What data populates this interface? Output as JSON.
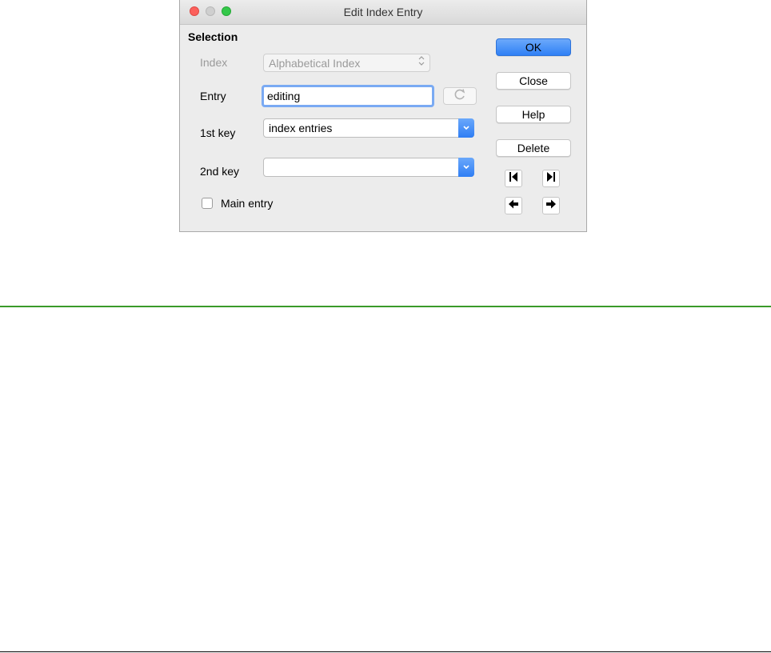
{
  "window": {
    "title": "Edit Index Entry"
  },
  "selection": {
    "heading": "Selection",
    "index_label": "Index",
    "index_value": "Alphabetical Index",
    "entry_label": "Entry",
    "entry_value": "editing",
    "key1_label": "1st key",
    "key1_value": "index entries",
    "key2_label": "2nd key",
    "key2_value": "",
    "main_entry_label": "Main entry"
  },
  "buttons": {
    "ok": "OK",
    "close": "Close",
    "help": "Help",
    "delete": "Delete"
  },
  "colors": {
    "accent": "#2f80f5",
    "rule_green": "#3a9a2a"
  }
}
